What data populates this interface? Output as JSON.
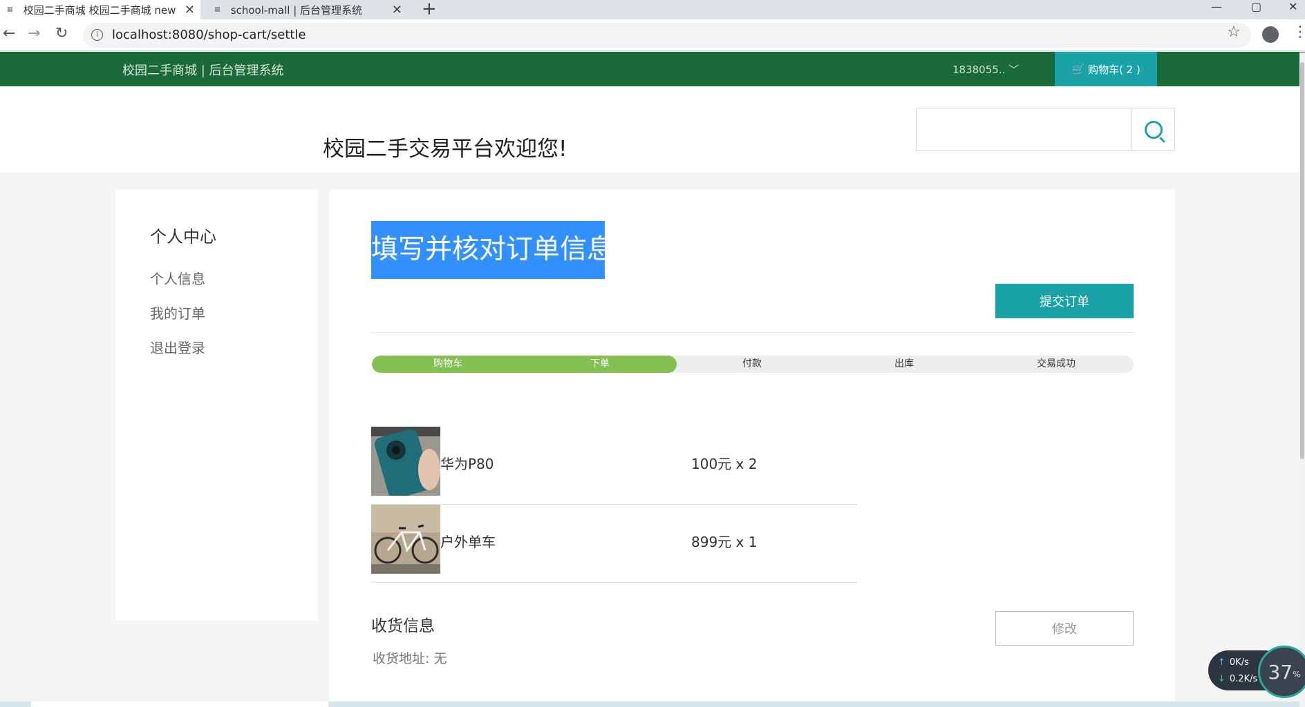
{
  "browser": {
    "tabs": [
      {
        "title": "校园二手商城 校园二手商城 new",
        "favicon": "grid-icon",
        "active": true
      },
      {
        "title": "school-mall | 后台管理系统",
        "favicon": "grid-icon",
        "active": false
      }
    ],
    "new_tab": "+",
    "url": "localhost:8080/shop-cart/settle",
    "window_controls": {
      "minimize": "—",
      "maximize": "▢",
      "close": "✕"
    }
  },
  "header": {
    "brand": "校园二手商城 | 后台管理系统",
    "user": "1838055.. ﹀",
    "cart_label": "购物车( 2 )"
  },
  "banner": {
    "welcome": "校园二手交易平台欢迎您!",
    "search_placeholder": ""
  },
  "sidebar": {
    "title": "个人中心",
    "items": [
      {
        "label": "个人信息"
      },
      {
        "label": "我的订单"
      },
      {
        "label": "退出登录"
      }
    ]
  },
  "order": {
    "title": "填写并核对订单信息",
    "submit_label": "提交订单",
    "progress_fraction": 0.4,
    "steps": [
      {
        "label": "购物车",
        "done": true
      },
      {
        "label": "下单",
        "done": true
      },
      {
        "label": "付款",
        "done": false
      },
      {
        "label": "出库",
        "done": false
      },
      {
        "label": "交易成功",
        "done": false
      }
    ],
    "items": [
      {
        "name": "华为P80",
        "price": "100元 x 2",
        "image": "phone-photo"
      },
      {
        "name": "户外单车",
        "price": "899元 x 1",
        "image": "bicycle-photo"
      }
    ],
    "shipping": {
      "title": "收货信息",
      "modify_label": "修改",
      "address": "收货地址:  无"
    }
  },
  "net_widget": {
    "upload": "0K/s",
    "download": "0.2K/s",
    "cpu": "37",
    "cpu_unit": "%"
  },
  "colors": {
    "header_green": "#1b6b3a",
    "teal": "#1aa3a6",
    "progress_green": "#84c051",
    "title_highlight": "#3390ff"
  }
}
